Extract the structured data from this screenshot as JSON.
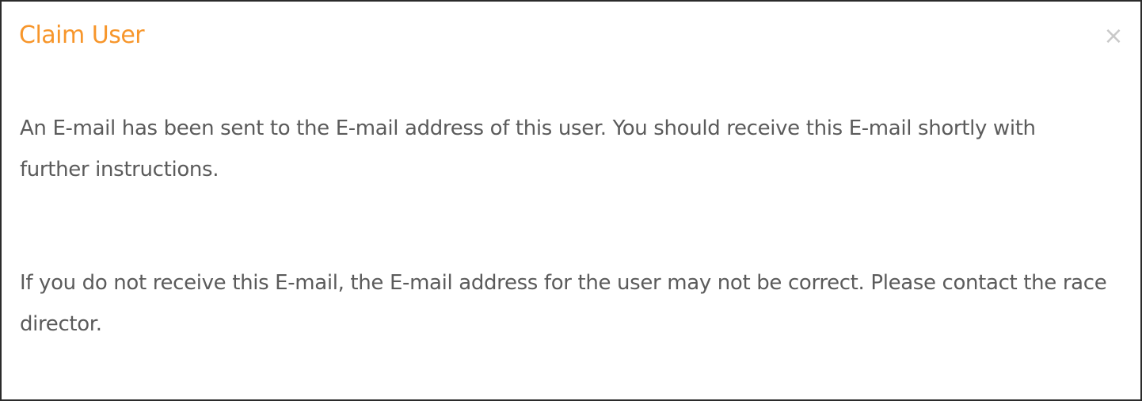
{
  "modal": {
    "title": "Claim User",
    "close_symbol": "×",
    "paragraphs": [
      "An E-mail has been sent to the E-mail address of this user. You should receive this E-mail shortly with further instructions.",
      "If you do not receive this E-mail, the E-mail address for the user may not be correct. Please contact the race director."
    ],
    "colors": {
      "title": "#f7962b",
      "body_text": "#5b5b5b",
      "close_icon": "#c9c9c9",
      "border": "#2b2b2b"
    },
    "icons": {
      "close": "close-icon"
    }
  }
}
